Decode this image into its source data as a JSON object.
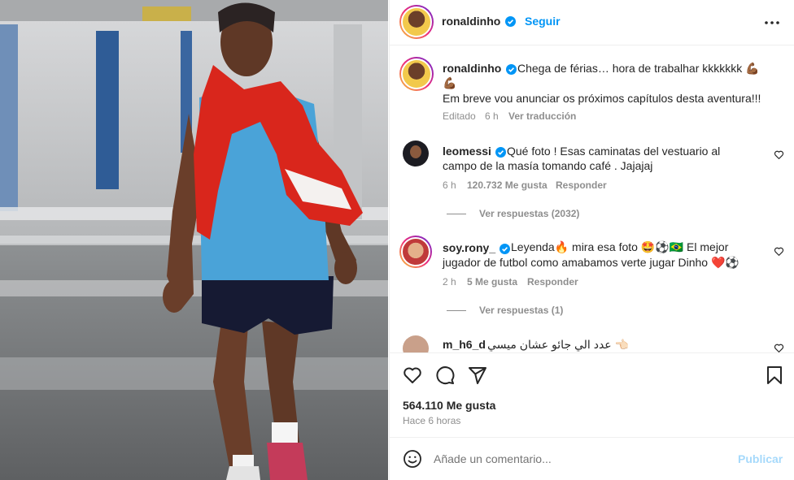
{
  "post": {
    "username": "ronaldinho",
    "follow_label": "Seguir",
    "more_icon": "more-horizontal-icon"
  },
  "caption": {
    "username": "ronaldinho",
    "text_line1": "Chega de férias… hora de trabalhar kkkkkkk 💪🏾",
    "text_line2": "💪🏾",
    "text_line3": "Em breve vou anunciar os próximos capítulos desta aventura!!!",
    "edited_label": "Editado",
    "time": "6 h",
    "translate_label": "Ver traducción"
  },
  "comments": [
    {
      "username": "leomessi",
      "text_line1": "Qué foto ! Esas caminatas del vestuario al",
      "text_line2": "campo de la masía tomando café . Jajajaj",
      "time": "6 h",
      "likes": "120.732 Me gusta",
      "reply_label": "Responder",
      "view_replies": "Ver respuestas (2032)"
    },
    {
      "username": "soy.rony_",
      "text_line1": "Leyenda🔥 mira esa foto 🤩⚽🇧🇷 El mejor",
      "text_line2": "jugador de futbol como amabamos verte jugar Dinho ❤️⚽",
      "time": "2 h",
      "likes": "5 Me gusta",
      "reply_label": "Responder",
      "view_replies": "Ver respuestas (1)"
    },
    {
      "username": "m_h6_d",
      "text_line1": "👈🏻 عدد الي جائو عشان ميسي"
    }
  ],
  "footer": {
    "likes": "564.110 Me gusta",
    "time_ago": "Hace 6 horas",
    "comment_placeholder": "Añade un comentario...",
    "publish_label": "Publicar"
  },
  "colors": {
    "accent_blue": "#0095f6",
    "text": "#262626",
    "muted": "#8e8e8e",
    "jersey": "#4aa3d8",
    "towel": "#d9261c"
  }
}
